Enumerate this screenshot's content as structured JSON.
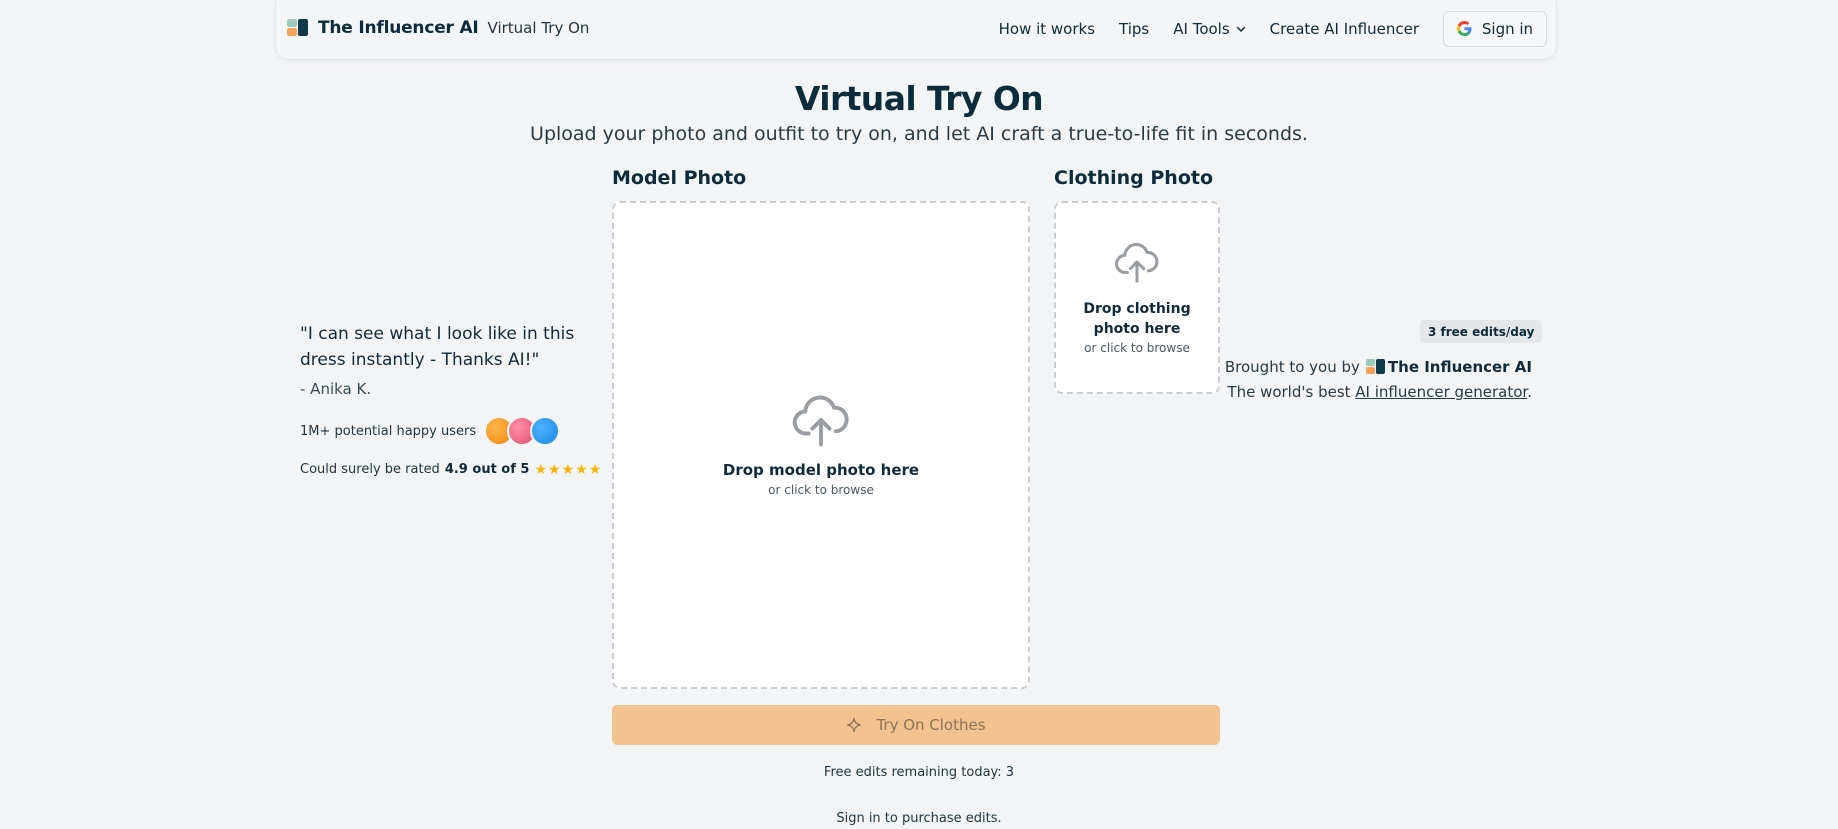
{
  "header": {
    "brand_name": "The Influencer AI",
    "brand_sub": "Virtual Try On",
    "nav": [
      "How it works",
      "Tips",
      "AI Tools",
      "Create AI Influencer"
    ],
    "signin_label": "Sign in"
  },
  "hero": {
    "title": "Virtual Try On",
    "subtitle": "Upload your photo and outfit to try on, and let AI craft a true-to-life fit in seconds."
  },
  "testimonial": {
    "quote": "\"I can see what I look like in this dress instantly - Thanks AI!\"",
    "author": "- Anika K.",
    "users_text": "1M+ potential happy users",
    "rating_prefix": "Could surely be rated",
    "rating_value": "4.9 out of 5",
    "stars": 5
  },
  "model_photo": {
    "label": "Model Photo",
    "drop_title": "Drop model photo here",
    "drop_sub": "or click to browse"
  },
  "clothing_photo": {
    "label": "Clothing Photo",
    "drop_title": "Drop clothing photo here",
    "drop_sub": "or click to browse"
  },
  "actions": {
    "try_on_label": "Try On Clothes",
    "remaining_text": "Free edits remaining today: 3",
    "purchase_text": "Sign in to purchase edits."
  },
  "sidebar_right": {
    "badge": "3 free edits/day",
    "brought_prefix": "Brought to you by",
    "brought_brand": "The Influencer AI",
    "worlds_prefix": "The world's best",
    "worlds_link": "AI influencer generator",
    "worlds_suffix": "."
  },
  "colors": {
    "accent_button": "#f2c38f",
    "star": "#f5b400",
    "avatar_1": "#f39a1e",
    "avatar_2": "#f0678a",
    "avatar_3": "#2196f3"
  },
  "icons": [
    "google-icon",
    "chevron-down-icon",
    "cloud-upload-icon",
    "sparkle-icon",
    "star-icon"
  ]
}
